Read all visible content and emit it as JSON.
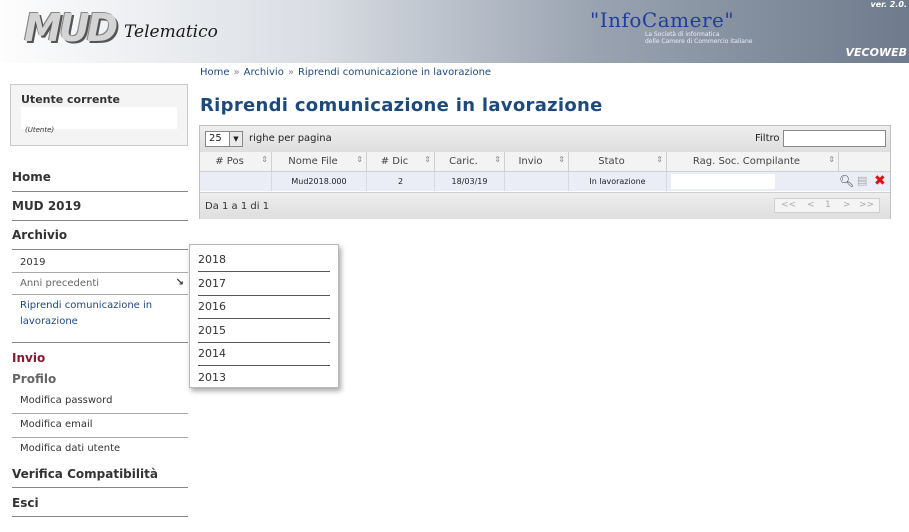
{
  "header": {
    "logo_mud": "MUD",
    "logo_telematico": "Telematico",
    "infocamere": "\"InfoCamere\"",
    "infocamere_sub_1": "La Società di informatica",
    "infocamere_sub_2": "delle Camere di Commercio italiane",
    "version": "ver. 2.0.",
    "app_code": "VECOWEB"
  },
  "breadcrumb": {
    "items": [
      "Home",
      "Archivio",
      "Riprendi comunicazione in lavorazione"
    ],
    "separator": "»"
  },
  "page_title": "Riprendi comunicazione in lavorazione",
  "user_box": {
    "title": "Utente corrente",
    "role": "(Utente)"
  },
  "nav": {
    "home": "Home",
    "mud2019": "MUD 2019",
    "archivio": "Archivio",
    "archivio_2019": "2019",
    "anni_precedenti": "Anni precedenti",
    "anni_precedenti_arrow": "↘",
    "riprendi_1": "Riprendi comunicazione in",
    "riprendi_2": "lavorazione",
    "invio": "Invio",
    "profilo": "Profilo",
    "modifica_password": "Modifica password",
    "modifica_email": "Modifica email",
    "modifica_dati": "Modifica dati utente",
    "verifica": "Verifica Compatibilità",
    "esci": "Esci",
    "colors": {
      "invio": "#8b1a2e",
      "profilo": "#666666",
      "default": "#333333"
    }
  },
  "grid": {
    "rows_per_page_value": "25",
    "rows_per_page_label": "righe per pagina",
    "filter_label": "Filtro",
    "filter_value": "",
    "columns": [
      "# Pos",
      "Nome File",
      "# Dic",
      "Caric.",
      "Invio",
      "Stato",
      "Rag. Soc. Compilante"
    ],
    "rows": [
      {
        "pos": "",
        "nome_file": "Mud2018.000",
        "dic": "2",
        "caric": "18/03/19",
        "invio": "",
        "stato": "In lavorazione",
        "rag_soc": ""
      }
    ],
    "footer_info": "Da 1 a 1 di 1",
    "pager": {
      "first": "<<",
      "prev": "<",
      "page": "1",
      "next": ">",
      "last": ">>"
    },
    "row_icons": [
      "search-icon",
      "edit-icon",
      "delete-icon"
    ]
  },
  "dropdown": {
    "years": [
      "2018",
      "2017",
      "2016",
      "2015",
      "2014",
      "2013"
    ]
  }
}
